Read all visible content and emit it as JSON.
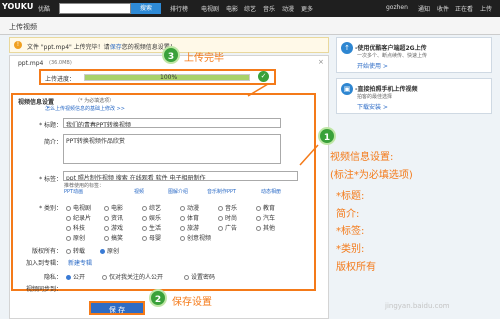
{
  "topbar": {
    "logo_main": "YOUKU",
    "logo_sub": "优酷",
    "search_button": "搜索",
    "nav": [
      "排行榜",
      "电视剧",
      "电影",
      "综艺",
      "音乐",
      "动漫",
      "更多"
    ],
    "user": "gozhen",
    "right_nav": [
      "通知",
      "收件",
      "正在看",
      "上传"
    ]
  },
  "page_title": "上传视频",
  "notice": {
    "prefix": "文件 \"ppt.mp4\" 上传完毕！请",
    "link": "保存",
    "suffix": "您的视频信息设置！"
  },
  "file": {
    "name": "ppt.mp4",
    "size": "(36.0MB)"
  },
  "progress": {
    "label": "上传进度：",
    "percent_text": "100%",
    "fraction": 1.0
  },
  "info": {
    "title": "视频信息设置",
    "required_note": "（* 为必填选项）",
    "hint": "怎么上传视频信息的基础上修改 >>",
    "title_label": "* 标题：",
    "title_value": "我们的青春PPT转换视频",
    "intro_label": "简介：",
    "intro_value": "PPT转换视频作品欣赏",
    "tags_label": "* 标签：",
    "tags_value": "ppt 照片制作视频 搜索 在线观看 软件 电子相册制作",
    "tags_hint": "推荐使用的标签：",
    "tag_suggestions": [
      "PPT动画",
      "视频",
      "图解介绍",
      "音乐制作PPT",
      "动态相册"
    ],
    "category_label": "* 类别：",
    "categories": [
      [
        "电视剧",
        "电影",
        "综艺",
        "动漫",
        "音乐",
        "教育"
      ],
      [
        "纪录片",
        "资讯",
        "娱乐",
        "体育",
        "时尚",
        "汽车"
      ],
      [
        "科技",
        "游戏",
        "生活",
        "旅游",
        "广告",
        "其他"
      ],
      [
        "原创",
        "搞笑",
        "母婴",
        "创意视频"
      ]
    ],
    "rights_label": "版权所有：",
    "rights_options": [
      "转载",
      "原创"
    ],
    "album_label": "加入到专辑：",
    "album_link": "新建专辑",
    "privacy_label": "隐私：",
    "privacy_options": [
      "公开",
      "仅对我关注的人公开",
      "设置密码"
    ],
    "sync_label": "视频同步到："
  },
  "save_button": "保 存",
  "sidebar": {
    "box1": {
      "title": "-使用优酷客户端超2G上传",
      "text": "一次多个、断点续传、快速上传",
      "link": "开始使用 >"
    },
    "box2": {
      "title": "-直接拍照手机上传视频",
      "text": "拍客的最佳选择",
      "link": "下载安装 >"
    }
  },
  "annotations": {
    "badge1": "1",
    "badge2": "2",
    "badge3": "3",
    "upload_done": "上传完毕",
    "save_settings": "保存设置",
    "note_lines": [
      "视频信息设置:",
      "(标注*为必填选项)",
      "*标题:",
      "简介:",
      "*标签:",
      "*类别:",
      "版权所有"
    ]
  },
  "watermark": "jingyan.baidu.com",
  "colors": {
    "annotation": "#f47a19",
    "accent": "#2e6cc4",
    "badge": "#3aa13a"
  }
}
